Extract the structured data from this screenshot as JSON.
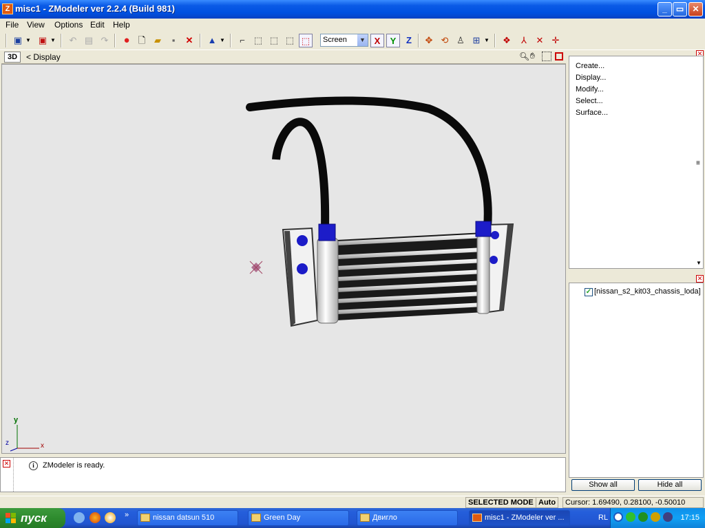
{
  "window": {
    "title": "misc1 - ZModeler ver 2.2.4 (Build 981)",
    "app_icon_letter": "Z",
    "minimize": "_",
    "maximize": "▭",
    "close": "✕"
  },
  "menu": {
    "items": [
      "File",
      "View",
      "Options",
      "Edit",
      "Help"
    ]
  },
  "toolbar": {
    "view_mode": "Screen",
    "axis_x": "X",
    "axis_y": "Y",
    "axis_z": "Z"
  },
  "viewport": {
    "tab_label": "3D",
    "view_name": "< Display",
    "axis_labels": {
      "y": "y",
      "z": "z",
      "x": "x"
    }
  },
  "log": {
    "message": "ZModeler is ready."
  },
  "commands": {
    "items": [
      "Create...",
      "Display...",
      "Modify...",
      "Select...",
      "Surface..."
    ]
  },
  "objects": {
    "items": [
      {
        "label": "[nissan_s2_kit03_chassis_loda]",
        "checked": true
      }
    ]
  },
  "panel_buttons": {
    "show_all": "Show all",
    "hide_all": "Hide all"
  },
  "status": {
    "mode": "SELECTED MODE",
    "auto": "Auto",
    "cursor": "Cursor: 1.69490, 0.28100, -0.50010"
  },
  "taskbar": {
    "start": "пуск",
    "tasks": [
      {
        "label": "nissan datsun 510",
        "active": false
      },
      {
        "label": "Green Day",
        "active": false
      },
      {
        "label": "Двигло",
        "active": false
      },
      {
        "label": "misc1 - ZModeler ver ...",
        "active": true
      }
    ],
    "lang": "RL",
    "clock": "17:15"
  },
  "colors": {
    "title_blue": "#0a5ae6",
    "taskbar_blue": "#245edb",
    "start_green": "#2e8b2e",
    "pipe_black": "#0a0a0a",
    "fitting_blue": "#1c1cc8"
  }
}
